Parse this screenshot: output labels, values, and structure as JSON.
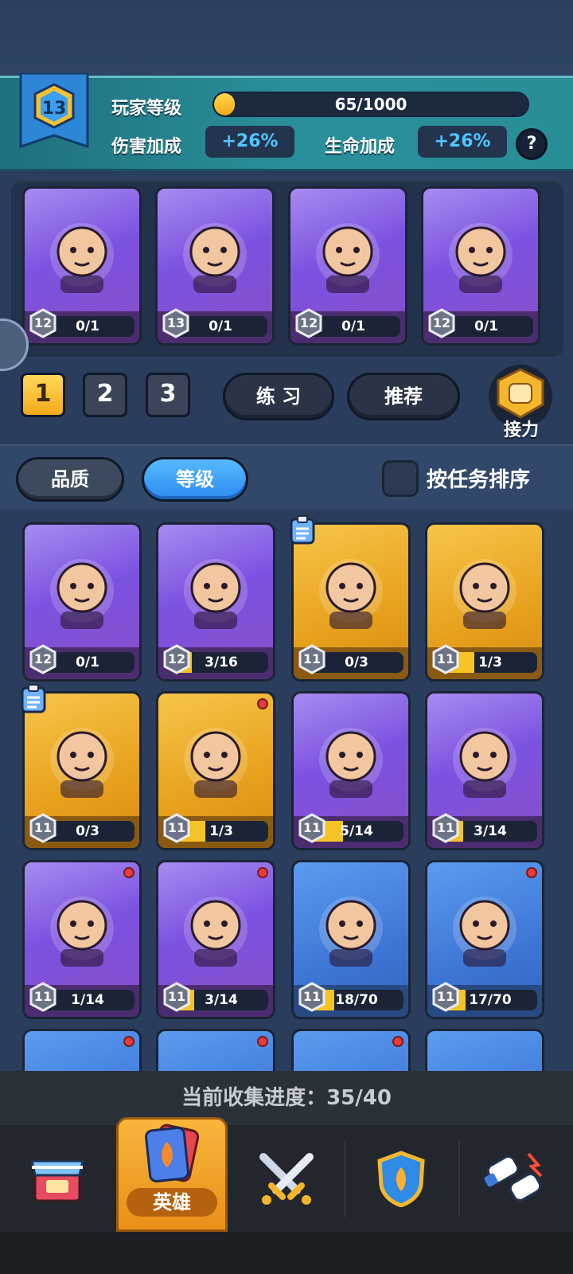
{
  "player": {
    "level": "13",
    "level_label": "玩家等级",
    "xp_text": "65/1000",
    "xp_fraction": 0.065,
    "damage_label": "伤害加成",
    "damage_value": "+26%",
    "health_label": "生命加成",
    "health_value": "+26%",
    "help": "?"
  },
  "team": [
    {
      "level": "12",
      "progress": "0/1",
      "fraction": 0,
      "rarity": "purple",
      "icon": "monk-hero-icon"
    },
    {
      "level": "13",
      "progress": "0/1",
      "fraction": 0,
      "rarity": "purple",
      "icon": "monkey-king-hero-icon"
    },
    {
      "level": "12",
      "progress": "0/1",
      "fraction": 0,
      "rarity": "purple",
      "icon": "dragon-hero-icon"
    },
    {
      "level": "12",
      "progress": "0/1",
      "fraction": 0,
      "rarity": "purple",
      "icon": "ghost-knight-hero-icon"
    }
  ],
  "team_tabs": [
    "1",
    "2",
    "3"
  ],
  "practice_label": "练 习",
  "recommend_label": "推荐",
  "relay_label": "接力",
  "sort": {
    "quality": "品质",
    "level": "等级",
    "task": "按任务排序"
  },
  "heroes": [
    {
      "level": "12",
      "progress": "0/1",
      "fraction": 0,
      "rarity": "purple",
      "dot": false,
      "task": false,
      "icon": "pirate-hero-icon"
    },
    {
      "level": "12",
      "progress": "3/16",
      "fraction": 0.19,
      "rarity": "purple",
      "dot": false,
      "task": false,
      "icon": "ice-princess-hero-icon"
    },
    {
      "level": "11",
      "progress": "0/3",
      "fraction": 0,
      "rarity": "gold",
      "dot": false,
      "task": true,
      "icon": "knight-hero-icon"
    },
    {
      "level": "11",
      "progress": "1/3",
      "fraction": 0.33,
      "rarity": "gold",
      "dot": false,
      "task": false,
      "icon": "white-cat-hero-icon"
    },
    {
      "level": "11",
      "progress": "0/3",
      "fraction": 0,
      "rarity": "gold",
      "dot": false,
      "task": true,
      "icon": "spider-hero-icon"
    },
    {
      "level": "11",
      "progress": "1/3",
      "fraction": 0.33,
      "rarity": "gold",
      "dot": true,
      "task": false,
      "icon": "archer-girl-hero-icon"
    },
    {
      "level": "11",
      "progress": "5/14",
      "fraction": 0.36,
      "rarity": "purple",
      "dot": false,
      "task": false,
      "icon": "orc-hero-icon"
    },
    {
      "level": "11",
      "progress": "3/14",
      "fraction": 0.21,
      "rarity": "purple",
      "dot": false,
      "task": false,
      "icon": "yeti-hero-icon"
    },
    {
      "level": "11",
      "progress": "1/14",
      "fraction": 0.07,
      "rarity": "purple",
      "dot": true,
      "task": false,
      "icon": "fire-monkey-hero-icon"
    },
    {
      "level": "11",
      "progress": "3/14",
      "fraction": 0.21,
      "rarity": "purple",
      "dot": true,
      "task": false,
      "icon": "straw-hat-ninja-hero-icon"
    },
    {
      "level": "11",
      "progress": "18/70",
      "fraction": 0.26,
      "rarity": "blue",
      "dot": false,
      "task": false,
      "icon": "viking-hero-icon"
    },
    {
      "level": "11",
      "progress": "17/70",
      "fraction": 0.24,
      "rarity": "blue",
      "dot": true,
      "task": false,
      "icon": "birds-hero-icon"
    }
  ],
  "collection": "当前收集进度：35/40",
  "nav": {
    "heroes_label": "英雄"
  },
  "colors": {
    "purple": "#7b52e0",
    "gold": "#e7a11d",
    "blue": "#3e76d6",
    "accent_blue": "#51c6ff",
    "xp_fill": "#f6c327"
  }
}
